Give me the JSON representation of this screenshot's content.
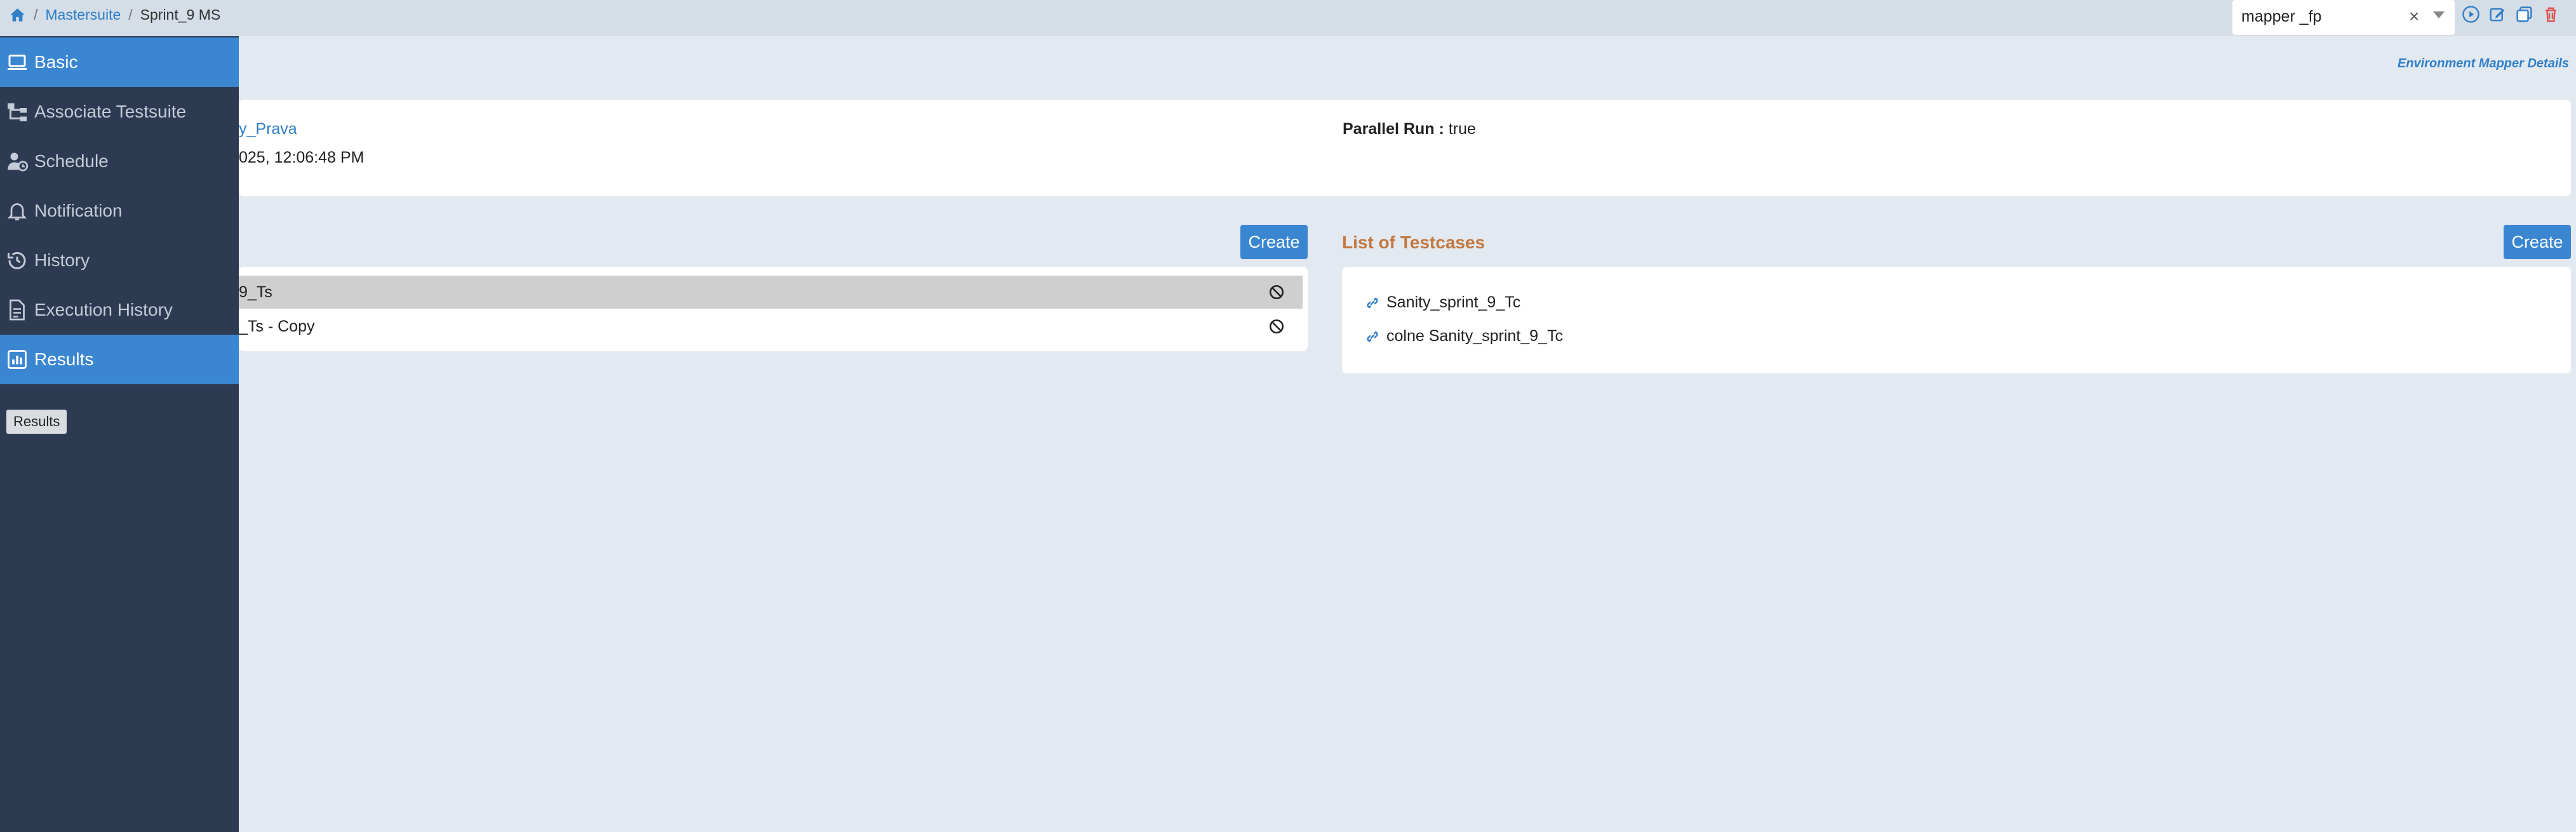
{
  "breadcrumb": {
    "parent": "Mastersuite",
    "current": "Sprint_9 MS"
  },
  "env_select": {
    "value": "mapper _fp",
    "clear": "×"
  },
  "tools": [
    "run-icon",
    "edit-icon",
    "copy-icon",
    "delete-icon"
  ],
  "sidebar": {
    "items": [
      {
        "label": "Basic",
        "icon": "laptop-icon"
      },
      {
        "label": "Associate Testsuite",
        "icon": "hierarchy-icon"
      },
      {
        "label": "Schedule",
        "icon": "user-clock-icon"
      },
      {
        "label": "Notification",
        "icon": "bell-icon"
      },
      {
        "label": "History",
        "icon": "history-icon"
      },
      {
        "label": "Execution History",
        "icon": "file-icon"
      },
      {
        "label": "Results",
        "icon": "chart-icon"
      }
    ],
    "tooltip": "Results"
  },
  "env_link": "Environment Mapper Details",
  "info": {
    "owner": "y_Prava",
    "date": "025, 12:06:48 PM",
    "parallel_label": "Parallel Run :",
    "parallel_value": "true"
  },
  "testsuites": {
    "create_label": "Create",
    "items": [
      "9_Ts",
      "_Ts - Copy"
    ]
  },
  "testcases": {
    "title": "List of Testcases",
    "create_label": "Create",
    "items": [
      "Sanity_sprint_9_Tc",
      "colne Sanity_sprint_9_Tc"
    ]
  },
  "colors": {
    "accent": "#3a86d1",
    "sidebar": "#2c3a52",
    "heading": "#c2783e",
    "danger": "#d9534f"
  }
}
